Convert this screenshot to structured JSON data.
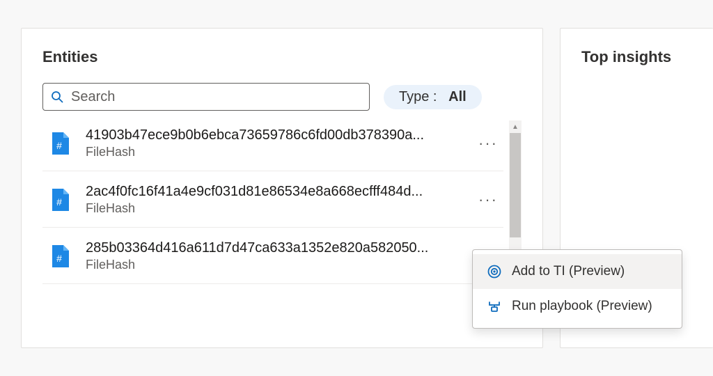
{
  "entities_panel": {
    "title": "Entities",
    "search_placeholder": "Search",
    "filter": {
      "label": "Type :",
      "value": "All"
    },
    "items": [
      {
        "hash": "41903b47ece9b0b6ebca73659786c6fd00db378390a...",
        "type": "FileHash"
      },
      {
        "hash": "2ac4f0fc16f41a4e9cf031d81e86534e8a668ecfff484d...",
        "type": "FileHash"
      },
      {
        "hash": "285b03364d416a611d7d47ca633a1352e820a582050...",
        "type": "FileHash"
      }
    ]
  },
  "insights_panel": {
    "title": "Top insights"
  },
  "context_menu": {
    "items": [
      {
        "label": "Add to TI (Preview)",
        "icon": "target"
      },
      {
        "label": "Run playbook (Preview)",
        "icon": "playbook"
      }
    ]
  },
  "colors": {
    "accent": "#0f6cbd",
    "icon_blue": "#1e88e5"
  }
}
